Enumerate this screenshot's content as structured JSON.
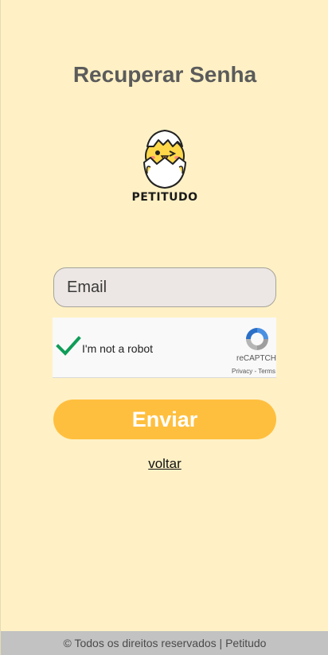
{
  "page": {
    "title": "Recuperar Senha"
  },
  "logo": {
    "text": "PETITUDO",
    "icon": "chick-in-egg-icon"
  },
  "form": {
    "email_placeholder": "Email",
    "email_value": "",
    "submit_label": "Enviar",
    "back_link": "voltar"
  },
  "captcha": {
    "label": "I'm not a robot",
    "checked": true,
    "brand": "reCAPTCHA",
    "links": "Privacy - Terms"
  },
  "footer": {
    "text": "© Todos os direitos reservados | Petitudo"
  },
  "colors": {
    "background": "#fff1c5",
    "accent": "#ffbf3e",
    "check": "#0f9d58",
    "footer": "#c2c2c2"
  }
}
